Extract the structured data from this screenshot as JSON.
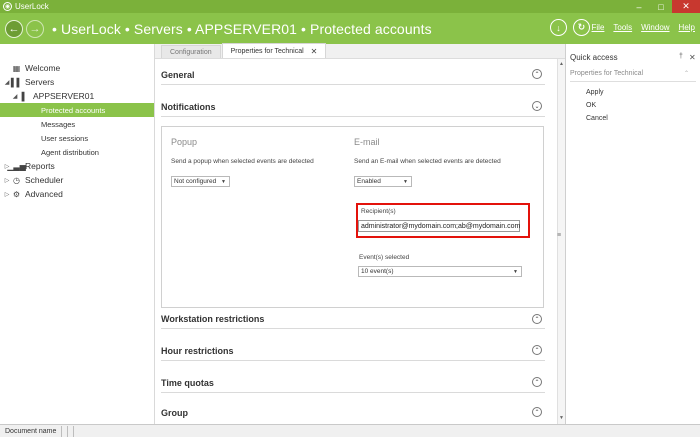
{
  "window": {
    "title": "UserLock"
  },
  "header": {
    "breadcrumb": "• UserLock • Servers • APPSERVER01 • Protected accounts",
    "menu": [
      "File",
      "Tools",
      "Window",
      "Help"
    ]
  },
  "sidebar": {
    "items": [
      {
        "label": "Welcome",
        "icon": "grid-icon"
      },
      {
        "label": "Servers",
        "icon": "servers-icon"
      },
      {
        "label": "APPSERVER01",
        "icon": "server-icon"
      },
      {
        "label": "Protected accounts"
      },
      {
        "label": "Messages"
      },
      {
        "label": "User sessions"
      },
      {
        "label": "Agent distribution"
      },
      {
        "label": "Reports",
        "icon": "bar-chart-icon"
      },
      {
        "label": "Scheduler",
        "icon": "clock-icon"
      },
      {
        "label": "Advanced",
        "icon": "gear-icon"
      }
    ]
  },
  "tabs": [
    {
      "label": "Configuration",
      "active": false
    },
    {
      "label": "Properties for Technical",
      "active": true
    }
  ],
  "sections": {
    "general": "General",
    "notifications": "Notifications",
    "workstation": "Workstation restrictions",
    "hour": "Hour restrictions",
    "quotas": "Time quotas",
    "group": "Group"
  },
  "popup": {
    "title": "Popup",
    "desc": "Send a popup when selected events are detected",
    "value": "Not configured"
  },
  "email": {
    "title": "E-mail",
    "desc": "Send an E-mail when selected events are detected",
    "value": "Enabled",
    "recipients_label": "Recipient(s)",
    "recipients_value": "administrator@mydomain.com;ab@mydomain.com",
    "events_label": "Event(s) selected",
    "events_value": "10 event(s)"
  },
  "quick_access": {
    "title": "Quick access",
    "section": "Properties for Technical",
    "actions": [
      "Apply",
      "OK",
      "Cancel"
    ]
  },
  "statusbar": {
    "document": "Document name"
  },
  "colors": {
    "accent": "#8bc34a",
    "highlight": "#e3120b"
  }
}
